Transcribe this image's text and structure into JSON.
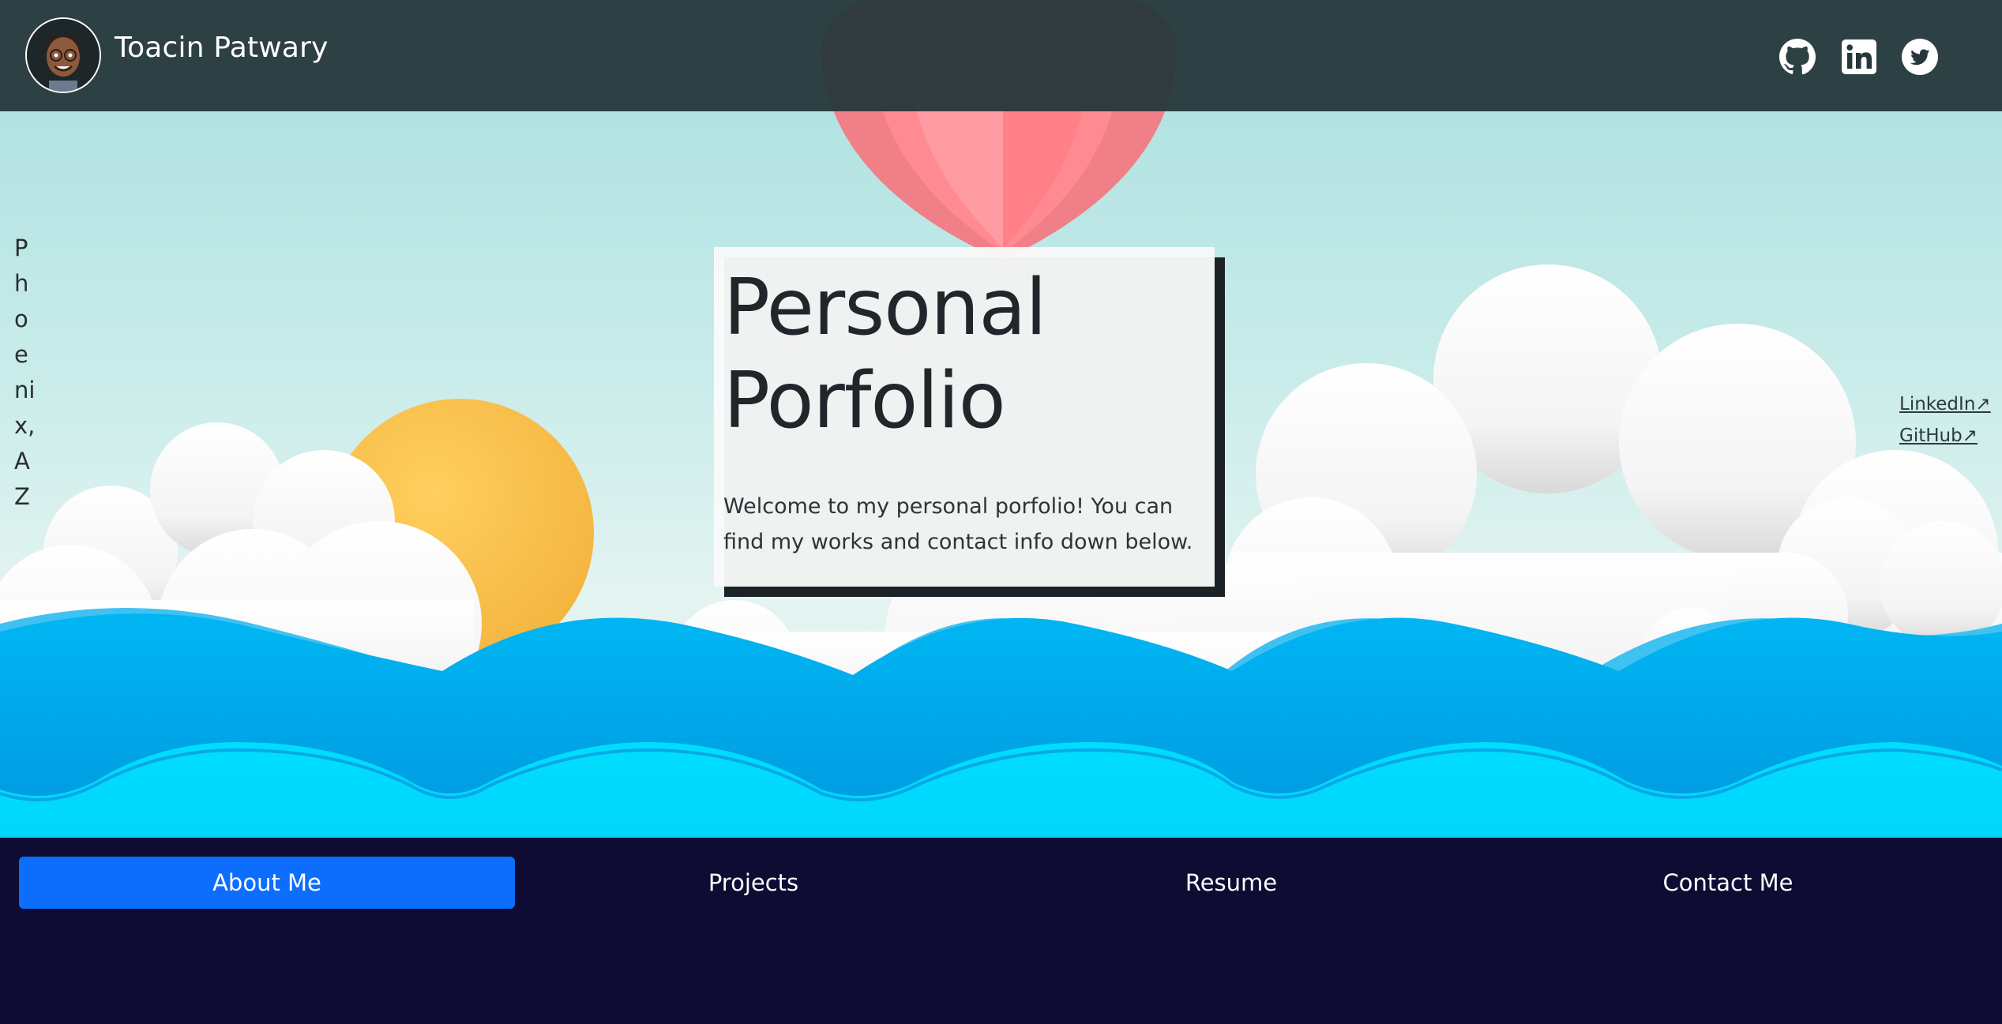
{
  "header": {
    "site_name": "Toacin Patwary",
    "social": [
      {
        "name": "github",
        "icon": "github-icon"
      },
      {
        "name": "linkedin",
        "icon": "linkedin-icon"
      },
      {
        "name": "twitter",
        "icon": "twitter-icon"
      }
    ]
  },
  "hero": {
    "location": "Phoenix, AZ",
    "title": "Personal Porfolio",
    "welcome": "Welcome to my personal porfolio! You can find my works and contact info down below.",
    "side_links": [
      {
        "label": "LinkedIn↗"
      },
      {
        "label": "GitHub↗"
      }
    ]
  },
  "bottom_nav": {
    "items": [
      {
        "label": "About Me",
        "active": true
      },
      {
        "label": "Projects",
        "active": false
      },
      {
        "label": "Resume",
        "active": false
      },
      {
        "label": "Contact Me",
        "active": false
      }
    ]
  },
  "colors": {
    "topbar": "#26373a",
    "active_tab": "#0d6efd",
    "bottom_nav": "#0e0c33",
    "sea": "#03b5f2",
    "sun": "#fdc44f",
    "balloon": "#ff8e95"
  }
}
